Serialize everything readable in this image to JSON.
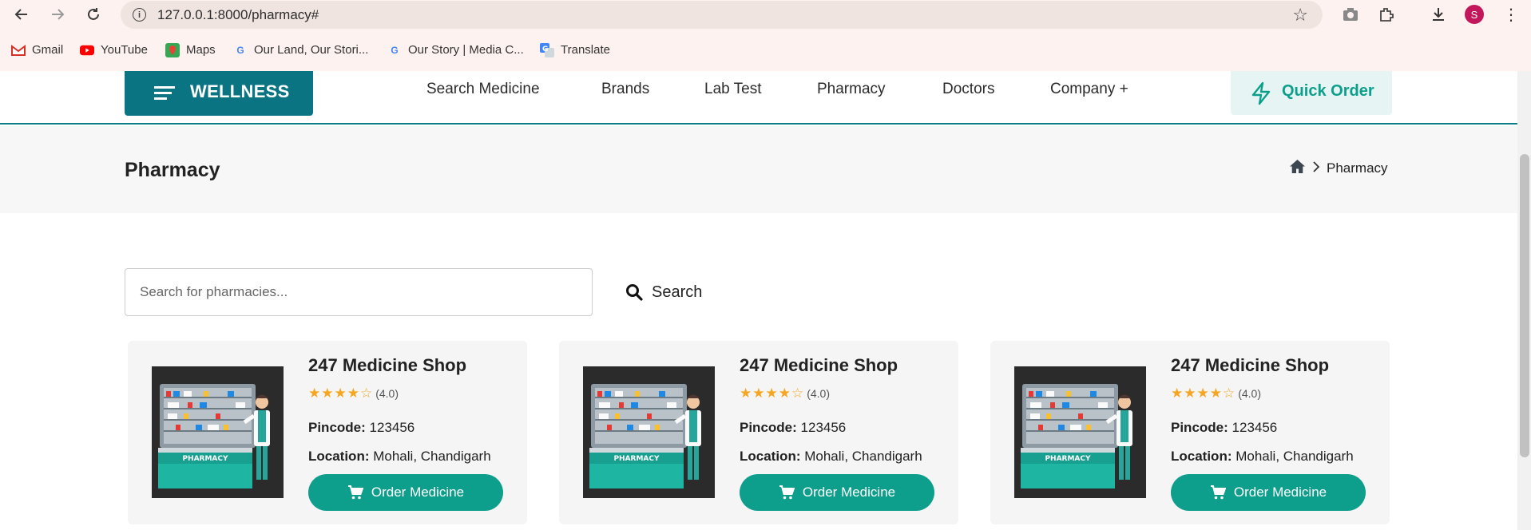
{
  "browser": {
    "url": "127.0.0.1:8000/pharmacy#",
    "profile_initial": "S",
    "bookmarks": [
      "Gmail",
      "YouTube",
      "Maps",
      "Our Land, Our Stori...",
      "Our Story | Media C...",
      "Translate"
    ]
  },
  "header": {
    "logo": "WELLNESS",
    "nav": [
      "Search Medicine",
      "Brands",
      "Lab Test",
      "Pharmacy",
      "Doctors",
      "Company +"
    ],
    "quick_order": "Quick Order"
  },
  "title_band": {
    "title": "Pharmacy",
    "breadcrumb_current": "Pharmacy"
  },
  "search": {
    "placeholder": "Search for pharmacies...",
    "button_label": "Search"
  },
  "cards": [
    {
      "name": "247 Medicine Shop",
      "rating_text": "(4.0)",
      "rating": 4,
      "pincode_label": "Pincode:",
      "pincode": "123456",
      "location_label": "Location:",
      "location": "Mohali, Chandigarh",
      "button": "Order Medicine",
      "image_label": "PHARMACY"
    },
    {
      "name": "247 Medicine Shop",
      "rating_text": "(4.0)",
      "rating": 4,
      "pincode_label": "Pincode:",
      "pincode": "123456",
      "location_label": "Location:",
      "location": "Mohali, Chandigarh",
      "button": "Order Medicine",
      "image_label": "PHARMACY"
    },
    {
      "name": "247 Medicine Shop",
      "rating_text": "(4.0)",
      "rating": 4,
      "pincode_label": "Pincode:",
      "pincode": "123456",
      "location_label": "Location:",
      "location": "Mohali, Chandigarh",
      "button": "Order Medicine",
      "image_label": "PHARMACY"
    }
  ],
  "colors": {
    "brand": "#0a7483",
    "accent": "#0e9f8c",
    "star": "#f5a623"
  }
}
